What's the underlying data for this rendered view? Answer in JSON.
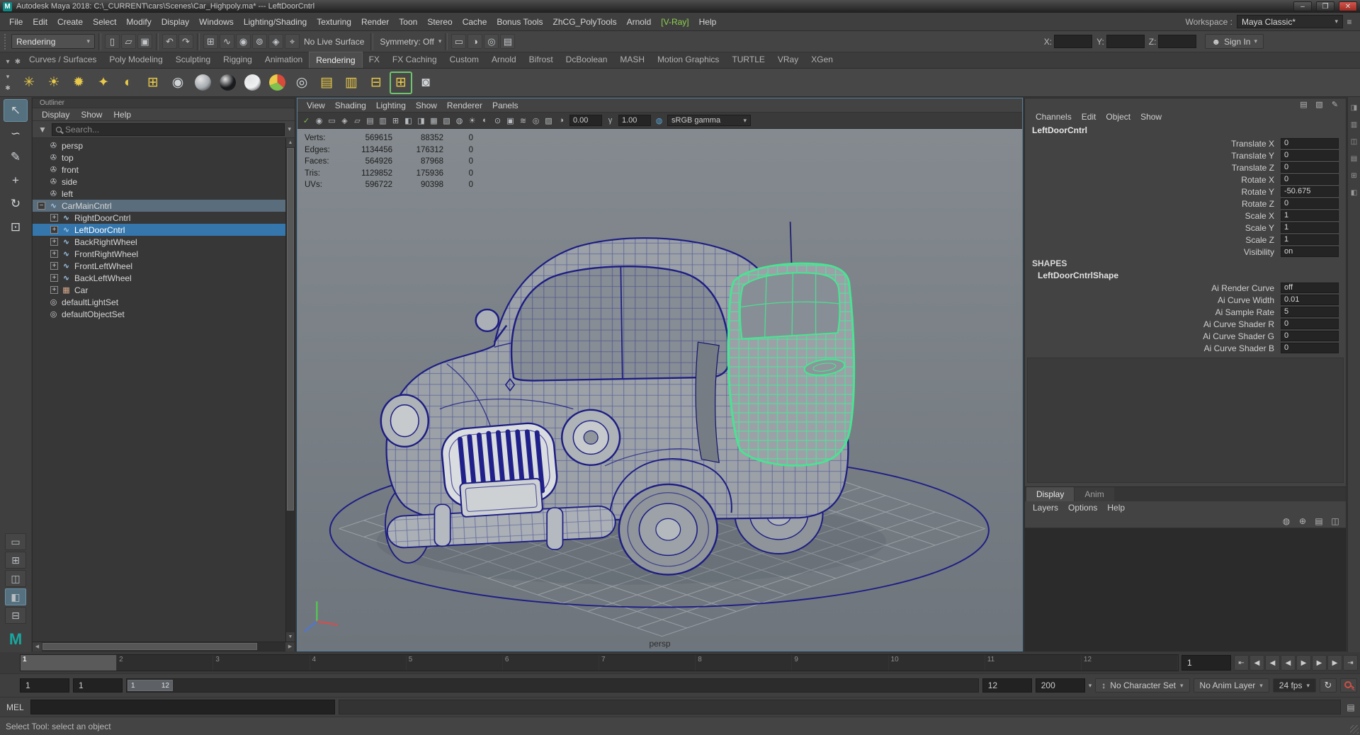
{
  "titlebar": {
    "title": "Autodesk Maya 2018: C:\\_CURRENT\\cars\\Scenes\\Car_Highpoly.ma*  ---  LeftDoorCntrl",
    "minimize": "–",
    "maximize": "❐",
    "close": "✕",
    "badge": "M"
  },
  "menubar": {
    "items": [
      {
        "label": "File"
      },
      {
        "label": "Edit"
      },
      {
        "label": "Create"
      },
      {
        "label": "Select"
      },
      {
        "label": "Modify"
      },
      {
        "label": "Display"
      },
      {
        "label": "Windows"
      },
      {
        "label": "Lighting/Shading"
      },
      {
        "label": "Texturing"
      },
      {
        "label": "Render"
      },
      {
        "label": "Toon"
      },
      {
        "label": "Stereo"
      },
      {
        "label": "Cache"
      },
      {
        "label": "Bonus Tools"
      },
      {
        "label": "ZhCG_PolyTools"
      },
      {
        "label": "Arnold"
      },
      {
        "label": "[V-Ray]",
        "state": "vray"
      },
      {
        "label": "Help"
      }
    ],
    "workspace_label": "Workspace :",
    "workspace_value": "Maya Classic*"
  },
  "statusline": {
    "menuset": "Rendering",
    "file_icons": [
      {
        "name": "new-scene-icon",
        "glyph": "▯"
      },
      {
        "name": "open-scene-icon",
        "glyph": "▱"
      },
      {
        "name": "save-scene-icon",
        "glyph": "▣"
      }
    ],
    "history_icons": [
      {
        "name": "undo-icon",
        "glyph": "↶"
      },
      {
        "name": "redo-icon",
        "glyph": "↷"
      }
    ],
    "snap_icons": [
      {
        "name": "snap-grid-icon",
        "glyph": "⊞"
      },
      {
        "name": "snap-curve-icon",
        "glyph": "∿"
      },
      {
        "name": "snap-point-icon",
        "glyph": "◉"
      },
      {
        "name": "snap-center-icon",
        "glyph": "⊚"
      },
      {
        "name": "snap-plane-icon",
        "glyph": "◈"
      },
      {
        "name": "make-live-icon",
        "glyph": "⌖"
      }
    ],
    "no_live_surface": "No Live Surface",
    "symmetry": "Symmetry: Off",
    "render_icons": [
      {
        "name": "render-view-icon",
        "glyph": "▭"
      },
      {
        "name": "render-current-frame-icon",
        "glyph": "◑"
      },
      {
        "name": "ipr-render-icon",
        "glyph": "◎"
      },
      {
        "name": "render-settings-icon",
        "glyph": "▤"
      }
    ],
    "x_label": "X:",
    "y_label": "Y:",
    "z_label": "Z:",
    "sign_in": "Sign In",
    "person_glyph": "☻"
  },
  "shelf": {
    "left_icons": [
      {
        "name": "shelf-menu-icon",
        "glyph": "▾"
      },
      {
        "name": "shelf-gear-icon",
        "glyph": "✱"
      }
    ],
    "tabs": [
      {
        "label": "Curves / Surfaces"
      },
      {
        "label": "Poly Modeling"
      },
      {
        "label": "Sculpting"
      },
      {
        "label": "Rigging"
      },
      {
        "label": "Animation"
      },
      {
        "label": "Rendering",
        "state": "active"
      },
      {
        "label": "FX"
      },
      {
        "label": "FX Caching"
      },
      {
        "label": "Custom"
      },
      {
        "label": "Arnold"
      },
      {
        "label": "Bifrost"
      },
      {
        "label": "DcBoolean"
      },
      {
        "label": "MASH"
      },
      {
        "label": "Motion Graphics"
      },
      {
        "label": "TURTLE"
      },
      {
        "label": "VRay"
      },
      {
        "label": "XGen"
      }
    ],
    "icons": [
      {
        "name": "point-light-icon",
        "glyph": "✳",
        "color": "#e8c94a"
      },
      {
        "name": "spot-light-icon",
        "glyph": "☀",
        "color": "#e8c94a"
      },
      {
        "name": "directional-light-icon",
        "glyph": "✹",
        "color": "#e8c94a"
      },
      {
        "name": "area-light-icon",
        "glyph": "✦",
        "color": "#e8c94a"
      },
      {
        "name": "volume-light-icon",
        "glyph": "◐",
        "color": "#e8c94a"
      },
      {
        "name": "light-editor-icon",
        "glyph": "⊞",
        "color": "#e8c94a"
      },
      {
        "name": "shading-group-icon",
        "glyph": "◉",
        "color": "#cfd3d6"
      },
      {
        "name": "standard-surface-material-icon",
        "glyph": "",
        "state": "sphere",
        "color": "#a6abb0"
      },
      {
        "name": "blinn-material-icon",
        "glyph": "",
        "state": "sphere",
        "color": "#17191c"
      },
      {
        "name": "lambert-material-icon",
        "glyph": "",
        "state": "sphere",
        "color": "#eef0f2"
      },
      {
        "name": "render-current-frame-icon",
        "glyph": "",
        "state": "arnold"
      },
      {
        "name": "ipr-render-icon",
        "glyph": "◎",
        "color": "#cfd3d6"
      },
      {
        "name": "render-settings-icon",
        "glyph": "▤",
        "color": "#e8c94a"
      },
      {
        "name": "batch-render-icon",
        "glyph": "▥",
        "color": "#e8c94a"
      },
      {
        "name": "light-linking-icon",
        "glyph": "⊟",
        "color": "#e8c94a"
      },
      {
        "name": "render-flag-icon",
        "glyph": "⊞",
        "color": "#e8c94a",
        "state": "flagged"
      },
      {
        "name": "hypershade-icon",
        "glyph": "◙",
        "color": "#cfd3d6"
      }
    ]
  },
  "toolbox": {
    "tools": [
      {
        "name": "select-tool",
        "glyph": "↖",
        "state": "active"
      },
      {
        "name": "lasso-tool",
        "glyph": "∽"
      },
      {
        "name": "paint-select-tool",
        "glyph": "✎"
      },
      {
        "name": "move-tool",
        "glyph": "+"
      },
      {
        "name": "rotate-tool",
        "glyph": "↻"
      },
      {
        "name": "scale-tool",
        "glyph": "⊡"
      }
    ],
    "layouts": [
      {
        "name": "layout-single-pane-button",
        "glyph": "▭"
      },
      {
        "name": "layout-four-pane-button",
        "glyph": "⊞"
      },
      {
        "name": "layout-two-pane-button",
        "glyph": "◫"
      },
      {
        "name": "layout-outliner-persp-button",
        "glyph": "◧",
        "state": "active"
      },
      {
        "name": "layout-stacked-button",
        "glyph": "⊟"
      }
    ],
    "logo": "M"
  },
  "outliner": {
    "panel_title": "Outliner",
    "menus": [
      "Display",
      "Show",
      "Help"
    ],
    "search_placeholder": "Search...",
    "items": [
      {
        "label": "persp",
        "icon": "camera",
        "indent": 0,
        "name": "outliner-item-persp"
      },
      {
        "label": "top",
        "icon": "camera",
        "indent": 0,
        "name": "outliner-item-top"
      },
      {
        "label": "front",
        "icon": "camera",
        "indent": 0,
        "name": "outliner-item-front"
      },
      {
        "label": "side",
        "icon": "camera",
        "indent": 0,
        "name": "outliner-item-side"
      },
      {
        "label": "left",
        "icon": "camera",
        "indent": 0,
        "name": "outliner-item-left"
      },
      {
        "label": "CarMainCntrl",
        "icon": "curve",
        "expander": "−",
        "indent": 0,
        "state": "highlight",
        "name": "outliner-item-carmaincntrl"
      },
      {
        "label": "RightDoorCntrl",
        "icon": "curve",
        "expander": "+",
        "indent": 1,
        "name": "outliner-item-rightdoorcntrl"
      },
      {
        "label": "LeftDoorCntrl",
        "icon": "curve",
        "expander": "+",
        "indent": 1,
        "state": "selected",
        "name": "outliner-item-leftdoorcntrl"
      },
      {
        "label": "BackRightWheel",
        "icon": "curve",
        "expander": "+",
        "indent": 1,
        "name": "outliner-item-backrightwheel"
      },
      {
        "label": "FrontRightWheel",
        "icon": "curve",
        "expander": "+",
        "indent": 1,
        "name": "outliner-item-frontrightwheel"
      },
      {
        "label": "FrontLeftWheel",
        "icon": "curve",
        "expander": "+",
        "indent": 1,
        "name": "outliner-item-frontleftwheel"
      },
      {
        "label": "BackLeftWheel",
        "icon": "curve",
        "expander": "+",
        "indent": 1,
        "name": "outliner-item-backleftwheel"
      },
      {
        "label": "Car",
        "icon": "mesh",
        "expander": "+",
        "indent": 1,
        "name": "outliner-item-car"
      },
      {
        "label": "defaultLightSet",
        "icon": "set",
        "indent": 0,
        "name": "outliner-item-defaultlightset"
      },
      {
        "label": "defaultObjectSet",
        "icon": "set",
        "indent": 0,
        "name": "outliner-item-defaultobjectset"
      }
    ]
  },
  "viewport": {
    "menus": [
      "View",
      "Shading",
      "Lighting",
      "Show",
      "Renderer",
      "Panels"
    ],
    "toolbar_icons": [
      {
        "name": "selected-camera-check-icon",
        "glyph": "✓",
        "color": "#7ec14f"
      },
      {
        "name": "camera-lock-icon",
        "glyph": "◉"
      },
      {
        "name": "camera-attributes-icon",
        "glyph": "▭"
      },
      {
        "name": "bookmarks-icon",
        "glyph": "◈"
      },
      {
        "name": "image-plane-icon",
        "glyph": "▱"
      },
      {
        "name": "film-gate-icon",
        "glyph": "▤"
      },
      {
        "name": "resolution-gate-icon",
        "glyph": "▥"
      },
      {
        "name": "gate-mask-icon",
        "glyph": "⊞"
      },
      {
        "name": "field-chart-icon",
        "glyph": "◧"
      },
      {
        "name": "safe-action-icon",
        "glyph": "◨"
      },
      {
        "name": "safe-title-icon",
        "glyph": "▦"
      },
      {
        "name": "frame-all-icon",
        "glyph": "▧"
      },
      {
        "name": "wireframe-mode-icon",
        "glyph": "◍"
      },
      {
        "name": "lights-icon",
        "glyph": "☀"
      },
      {
        "name": "shaded-mode-icon",
        "glyph": "◐"
      },
      {
        "name": "textured-mode-icon",
        "glyph": "⊙"
      },
      {
        "name": "use-default-material-icon",
        "glyph": "▣"
      },
      {
        "name": "motion-blur-icon",
        "glyph": "≋"
      },
      {
        "name": "multisample-icon",
        "glyph": "◎"
      },
      {
        "name": "xray-mode-icon",
        "glyph": "▨"
      }
    ],
    "exposure_icon": "◑",
    "exposure": "0.00",
    "gamma_icon": "γ",
    "gamma": "1.00",
    "colorspace_icon": "◍",
    "colorspace": "sRGB gamma",
    "hud_rows": [
      {
        "label": "Verts:",
        "v1": "569615",
        "v2": "88352",
        "v3": "0"
      },
      {
        "label": "Edges:",
        "v1": "1134456",
        "v2": "176312",
        "v3": "0"
      },
      {
        "label": "Faces:",
        "v1": "564926",
        "v2": "87968",
        "v3": "0"
      },
      {
        "label": "Tris:",
        "v1": "1129852",
        "v2": "175936",
        "v3": "0"
      },
      {
        "label": "UVs:",
        "v1": "596722",
        "v2": "90398",
        "v3": "0"
      }
    ],
    "camera_label": "persp"
  },
  "channelbox": {
    "top_icons": [
      {
        "name": "channelbox-toggle-icon",
        "glyph": "▤"
      },
      {
        "name": "attribute-editor-toggle-icon",
        "glyph": "▧"
      },
      {
        "name": "tool-settings-toggle-icon",
        "glyph": "✎"
      }
    ],
    "menus": [
      "Channels",
      "Edit",
      "Object",
      "Show"
    ],
    "node_name": "LeftDoorCntrl",
    "attributes": [
      {
        "label": "Translate X",
        "value": "0"
      },
      {
        "label": "Translate Y",
        "value": "0"
      },
      {
        "label": "Translate Z",
        "value": "0"
      },
      {
        "label": "Rotate X",
        "value": "0"
      },
      {
        "label": "Rotate Y",
        "value": "-50.675"
      },
      {
        "label": "Rotate Z",
        "value": "0"
      },
      {
        "label": "Scale X",
        "value": "1"
      },
      {
        "label": "Scale Y",
        "value": "1"
      },
      {
        "label": "Scale Z",
        "value": "1"
      },
      {
        "label": "Visibility",
        "value": "on"
      }
    ],
    "shapes_label": "SHAPES",
    "shape_name": "LeftDoorCntrlShape",
    "shape_attributes": [
      {
        "label": "Ai Render Curve",
        "value": "off"
      },
      {
        "label": "Ai Curve Width",
        "value": "0.01"
      },
      {
        "label": "Ai Sample Rate",
        "value": "5"
      },
      {
        "label": "Ai Curve Shader R",
        "value": "0"
      },
      {
        "label": "Ai Curve Shader G",
        "value": "0"
      },
      {
        "label": "Ai Curve Shader B",
        "value": "0"
      }
    ]
  },
  "layer_editor": {
    "tabs": [
      {
        "label": "Display",
        "state": "active"
      },
      {
        "label": "Anim"
      }
    ],
    "menus": [
      "Layers",
      "Options",
      "Help"
    ],
    "icons": [
      {
        "name": "layer-visibility-icon",
        "glyph": "◍"
      },
      {
        "name": "create-empty-layer-icon",
        "glyph": "⊕"
      },
      {
        "name": "create-layer-from-selected-icon",
        "glyph": "▤"
      },
      {
        "name": "layer-list-mode-icon",
        "glyph": "◫"
      }
    ]
  },
  "rightstrip": {
    "icons": [
      {
        "name": "sidebar-channelbox-icon",
        "glyph": "◨"
      },
      {
        "name": "sidebar-attribute-editor-icon",
        "glyph": "▥"
      },
      {
        "name": "sidebar-tool-settings-icon",
        "glyph": "◫"
      },
      {
        "name": "sidebar-modeling-toolkit-icon",
        "glyph": "▤"
      },
      {
        "name": "sidebar-character-controls-icon",
        "glyph": "⊞"
      },
      {
        "name": "sidebar-xgen-icon",
        "glyph": "◧"
      }
    ]
  },
  "timeline": {
    "ticks": [
      {
        "label": "1",
        "state": "current"
      },
      {
        "label": "2"
      },
      {
        "label": "3"
      },
      {
        "label": "4"
      },
      {
        "label": "5"
      },
      {
        "label": "6"
      },
      {
        "label": "7"
      },
      {
        "label": "8"
      },
      {
        "label": "9"
      },
      {
        "label": "10"
      },
      {
        "label": "11"
      },
      {
        "label": "12"
      }
    ],
    "current_frame_field": "1",
    "playback_buttons": [
      {
        "name": "go-to-start-button",
        "glyph": "⇤"
      },
      {
        "name": "step-back-frame-button",
        "glyph": "◀"
      },
      {
        "name": "step-back-key-button",
        "glyph": "◀"
      },
      {
        "name": "play-backwards-button",
        "glyph": "◀"
      },
      {
        "name": "play-forwards-button",
        "glyph": "▶"
      },
      {
        "name": "step-forward-key-button",
        "glyph": "▶"
      },
      {
        "name": "step-forward-frame-button",
        "glyph": "▶"
      },
      {
        "name": "go-to-end-button",
        "glyph": "⇥"
      }
    ]
  },
  "rangebar": {
    "anim_start": "1",
    "playback_start": "1",
    "handle_start": "1",
    "handle_end": "12",
    "playback_end": "12",
    "anim_end": "200",
    "character_set": "No Character Set",
    "anim_layer": "No Anim Layer",
    "fps": "24 fps",
    "loop_glyph": "↻"
  },
  "commandline": {
    "mode_label": "MEL"
  },
  "helpline": {
    "text": "Select Tool: select an object"
  }
}
